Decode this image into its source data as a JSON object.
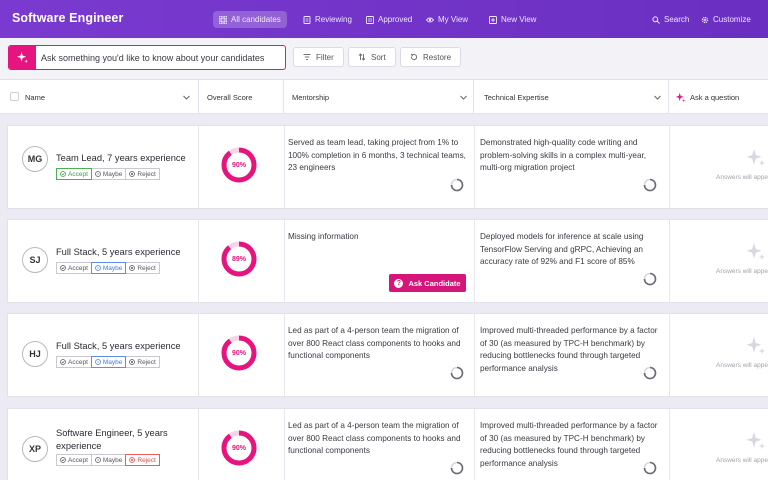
{
  "header": {
    "title": "Software Engineer",
    "nav": [
      {
        "label": "All candidates",
        "icon": "grid-icon",
        "active": true
      },
      {
        "label": "Reviewing",
        "icon": "document-icon"
      },
      {
        "label": "Approved",
        "icon": "checklist-icon"
      },
      {
        "label": "My View",
        "icon": "eye-icon"
      },
      {
        "label": "New View",
        "icon": "plus-square-icon"
      }
    ],
    "search_label": "Search",
    "customize_label": "Customize"
  },
  "toolbar": {
    "ask_placeholder": "Ask something you'd like to know about your candidates",
    "filter_label": "Filter",
    "sort_label": "Sort",
    "restore_label": "Restore"
  },
  "table": {
    "columns": {
      "name": "Name",
      "score": "Overall Score",
      "mentorship": "Mentorship",
      "technical": "Technical Expertise",
      "ask": "Ask a question"
    },
    "action_labels": {
      "accept": "Accept",
      "maybe": "Maybe",
      "reject": "Reject"
    },
    "ask_candidate_label": "Ask Candidate",
    "answers_placeholder": "Answers will appe",
    "rows": [
      {
        "initials": "MG",
        "title": "Team Lead, 7 years experience",
        "status": "accept",
        "score": 0.9,
        "score_label": "90%",
        "mentorship": "Served as team lead, taking project from 1% to 100% completion in 6 months, 3 technical teams, 23 engineers",
        "technical": "Demonstrated high-quality code writing and problem-solving skills in a complex multi-year, multi-org migration project"
      },
      {
        "initials": "SJ",
        "title": "Full Stack, 5 years experience",
        "status": "maybe",
        "score": 0.89,
        "score_label": "89%",
        "mentorship": "Missing information",
        "technical": "Deployed models for inference at scale using TensorFlow Serving and gRPC, Achieving an accuracy rate of 92% and F1 score of 85%"
      },
      {
        "initials": "HJ",
        "title": "Full Stack, 5 years experience",
        "status": "maybe",
        "score": 0.9,
        "score_label": "90%",
        "mentorship": "Led as part of a 4-person team the migration of over 800 React class  components to hooks and functional components",
        "technical": "Improved multi-threaded performance by a factor of 30 (as measured by TPC-H benchmark) by reducing bottlenecks found through targeted performance analysis"
      },
      {
        "initials": "XP",
        "title": "Software Engineer, 5 years experience",
        "status": "reject",
        "score": 0.9,
        "score_label": "90%",
        "mentorship": "Led as part of a 4-person team the migration of over 800 React class  components to hooks and functional components",
        "technical": "Improved multi-threaded performance by a factor of 30 (as measured by TPC-H benchmark) by reducing bottlenecks found through targeted performance analysis"
      }
    ]
  },
  "colors": {
    "brand_purple": "#7a3ad0",
    "accent_pink": "#e5147e",
    "accept": "#4caf50",
    "maybe": "#5b8def",
    "reject": "#ef5a5a"
  }
}
